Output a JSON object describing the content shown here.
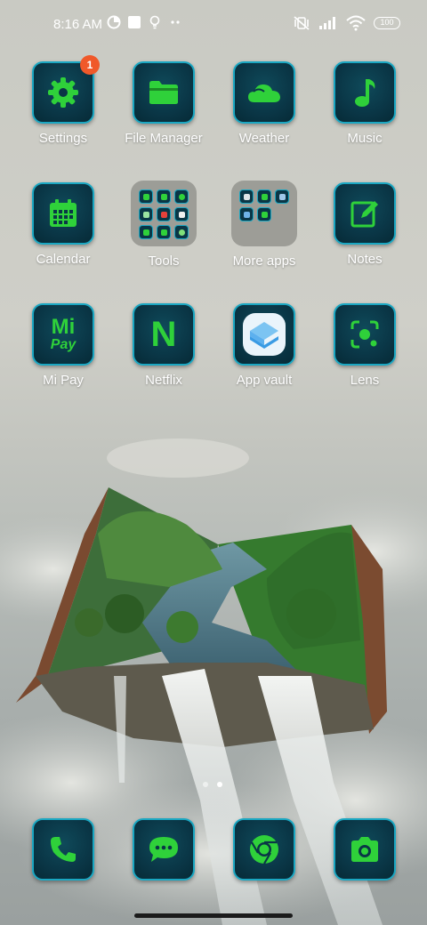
{
  "status_bar": {
    "time": "8:16 AM",
    "left_icons": [
      "data-saver-icon",
      "square-notification-icon",
      "bulb-icon",
      "more-dots-icon"
    ],
    "right_icons": [
      "muted-vibrate-icon",
      "signal-icon",
      "wifi-icon"
    ],
    "battery": "100"
  },
  "apps": [
    {
      "label": "Settings",
      "icon": "gear-icon",
      "badge": "1"
    },
    {
      "label": "File Manager",
      "icon": "folder-icon"
    },
    {
      "label": "Weather",
      "icon": "cloud-icon"
    },
    {
      "label": "Music",
      "icon": "music-note-icon"
    },
    {
      "label": "Calendar",
      "icon": "calendar-icon"
    },
    {
      "label": "Tools",
      "icon": "folder-grid"
    },
    {
      "label": "More apps",
      "icon": "folder-grid"
    },
    {
      "label": "Notes",
      "icon": "notes-pencil-icon"
    },
    {
      "label": "Mi Pay",
      "icon": "mi-pay-icon",
      "icon_text_top": "Mi",
      "icon_text_bottom": "Pay"
    },
    {
      "label": "Netflix",
      "icon": "netflix-icon",
      "icon_text": "N"
    },
    {
      "label": "App vault",
      "icon": "app-vault-icon"
    },
    {
      "label": "Lens",
      "icon": "lens-icon"
    }
  ],
  "dock": [
    {
      "name": "phone",
      "icon": "phone-icon"
    },
    {
      "name": "messages",
      "icon": "message-bubble-icon"
    },
    {
      "name": "chrome",
      "icon": "chrome-icon"
    },
    {
      "name": "camera",
      "icon": "camera-icon"
    }
  ],
  "page_indicator": {
    "pages": 2,
    "current": 2
  },
  "colors": {
    "icon_green": "#2fd13a",
    "tile_border": "#1aa7c2",
    "tile_bg": "#0a3646",
    "badge": "#f0592a"
  }
}
